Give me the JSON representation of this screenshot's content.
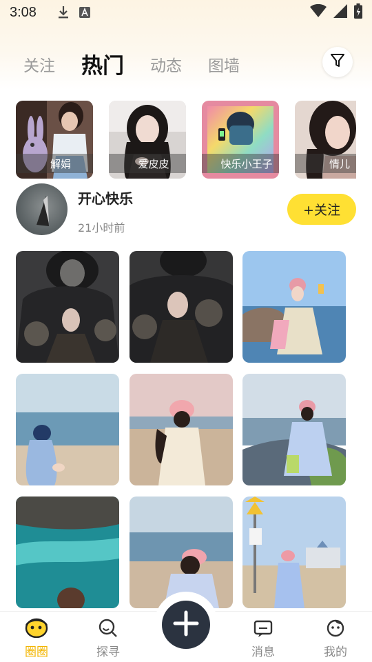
{
  "status_bar": {
    "time": "3:08"
  },
  "tabs": [
    {
      "label": "关注",
      "active": false
    },
    {
      "label": "热门",
      "active": true
    },
    {
      "label": "动态",
      "active": false
    },
    {
      "label": "图墙",
      "active": false
    }
  ],
  "filter_icon": "filter-icon",
  "stories": [
    {
      "label": "解娟"
    },
    {
      "label": "爱皮皮"
    },
    {
      "label": "快乐小王子"
    },
    {
      "label": "情儿"
    }
  ],
  "post": {
    "username": "开心快乐",
    "time": "21小时前",
    "follow_label": "+关注"
  },
  "bottom_nav": [
    {
      "label": "圈圈",
      "icon": "face-icon",
      "active": true
    },
    {
      "label": "探寻",
      "icon": "search-icon",
      "active": false
    },
    {
      "label": "消息",
      "icon": "message-icon",
      "active": false
    },
    {
      "label": "我的",
      "icon": "profile-icon",
      "active": false
    }
  ],
  "fab_icon": "plus-icon",
  "colors": {
    "accent": "#ffe033",
    "active_nav": "#f2b500",
    "fab": "#2b3340"
  }
}
